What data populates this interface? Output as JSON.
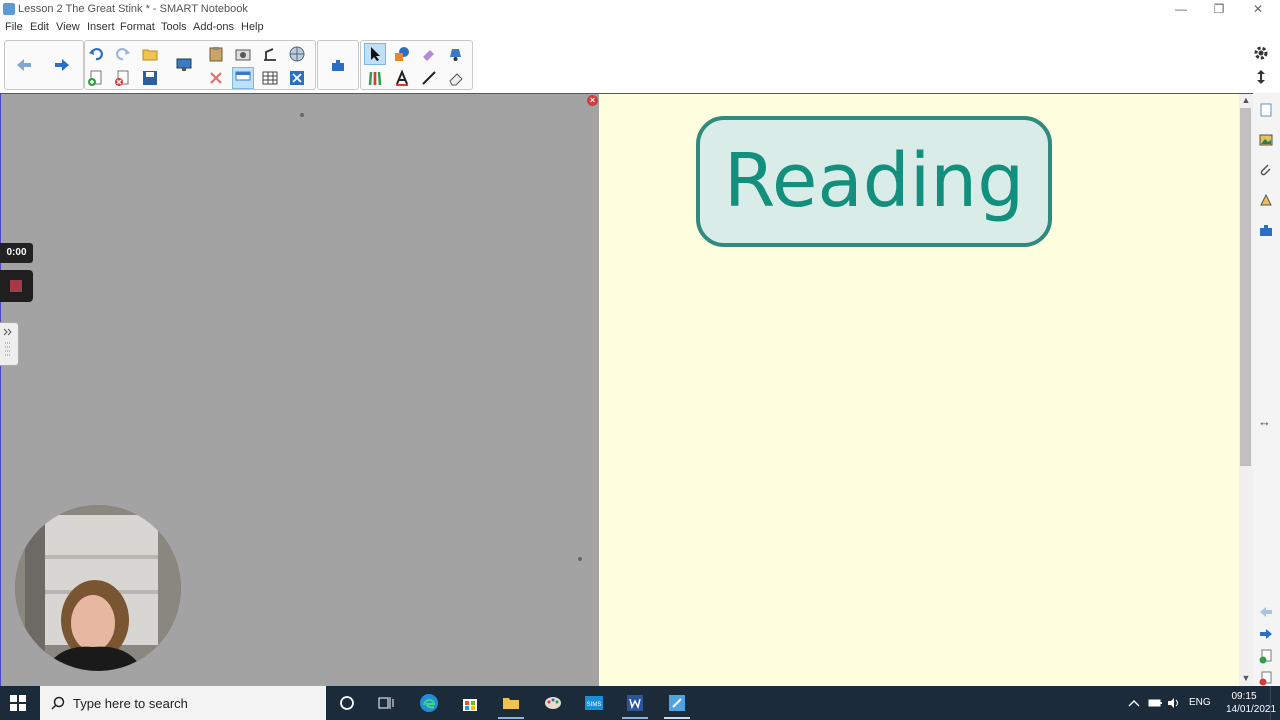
{
  "window": {
    "title": "Lesson 2 The Great Stink * - SMART Notebook",
    "minimize": "—",
    "restore": "❐",
    "close": "✕"
  },
  "menu": [
    "File",
    "Edit",
    "View",
    "Insert",
    "Format",
    "Tools",
    "Add-ons",
    "Help"
  ],
  "canvas": {
    "close_glyph": "×",
    "slide_title": "Reading"
  },
  "recorder": {
    "time": "0:00"
  },
  "scroll": {
    "up": "▲",
    "down": "▼"
  },
  "sidebar": {
    "resize_glyph": "↔"
  },
  "taskbar": {
    "search_placeholder": "Type here to search",
    "language": "ENG",
    "time": "09:15",
    "date": "14/01/2021"
  },
  "colors": {
    "accent": "#138f7e",
    "page_bg": "#ffffdf",
    "gray_area": "#a3a3a3",
    "taskbar": "#1c2b3a"
  }
}
